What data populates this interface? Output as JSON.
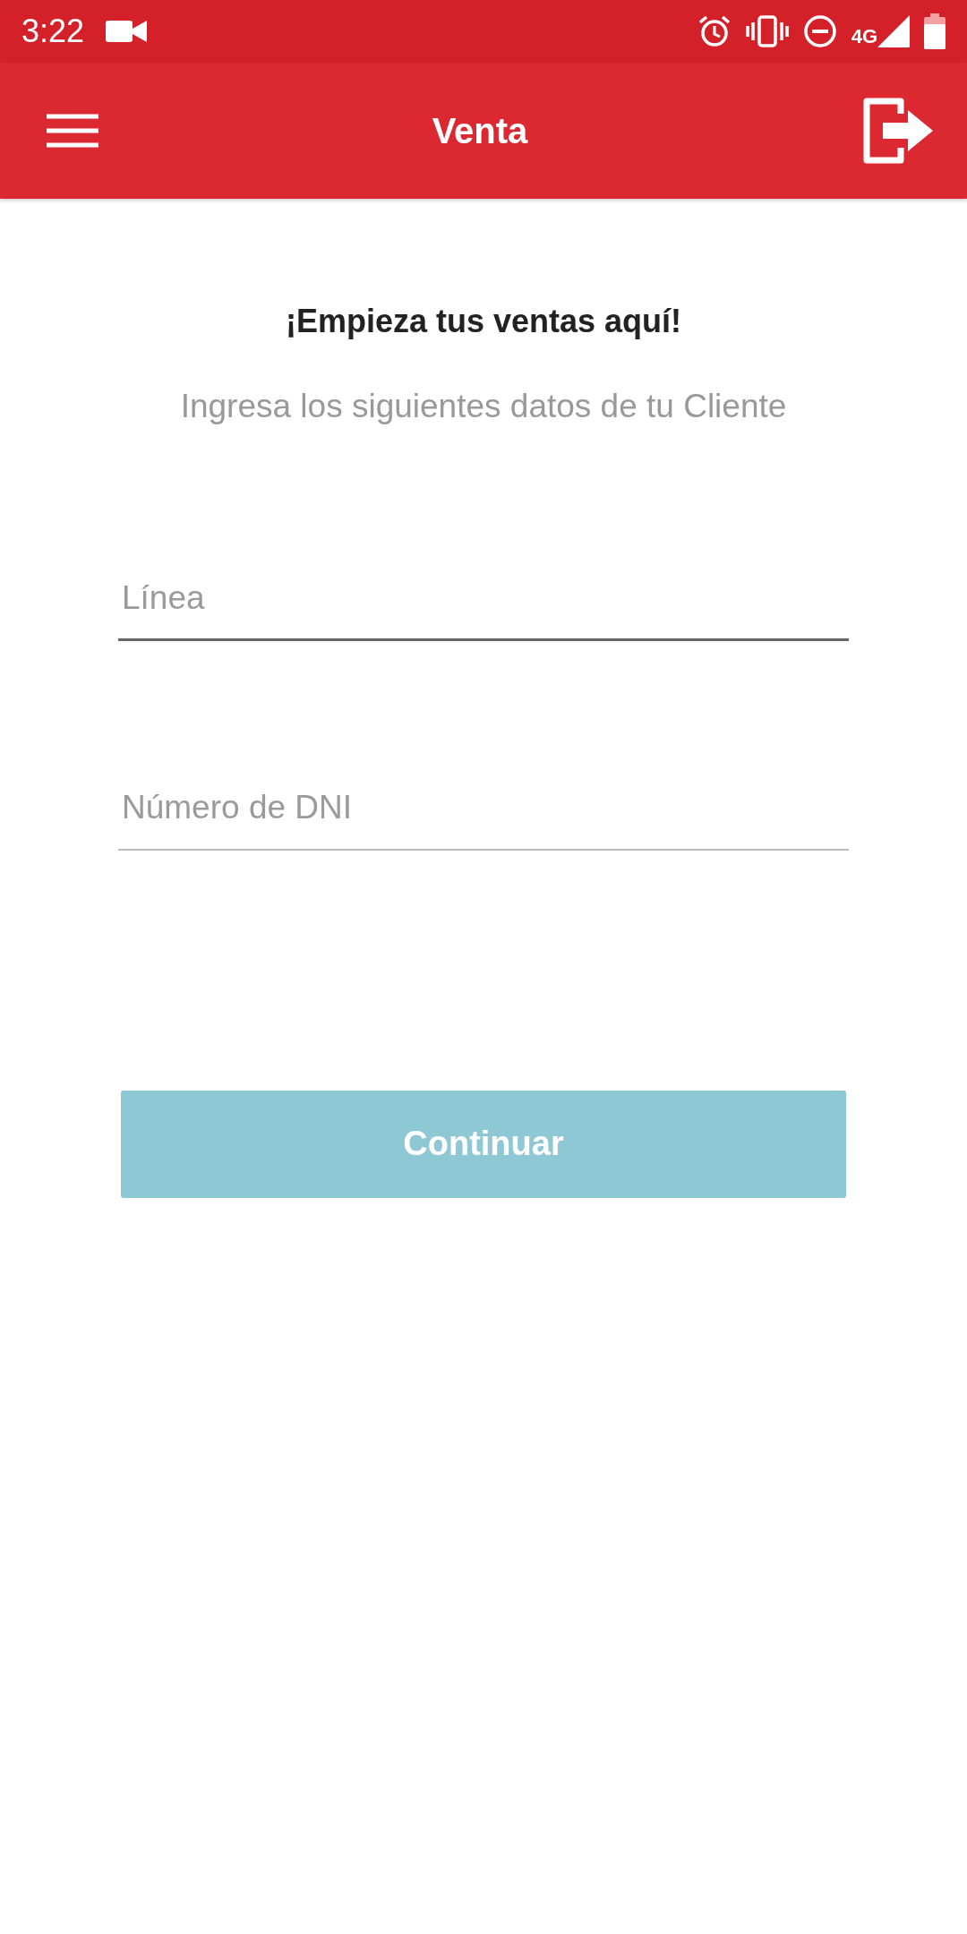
{
  "status_bar": {
    "time": "3:22",
    "network": "4G"
  },
  "app_bar": {
    "title": "Venta"
  },
  "intro": {
    "heading": "¡Empieza tus ventas aquí!",
    "subtitle": "Ingresa los siguientes datos de tu Cliente"
  },
  "fields": [
    {
      "placeholder": "Línea",
      "focused": true
    },
    {
      "placeholder": "Número de DNI",
      "focused": false
    }
  ],
  "button": {
    "label": "Continuar",
    "disabled": true
  }
}
